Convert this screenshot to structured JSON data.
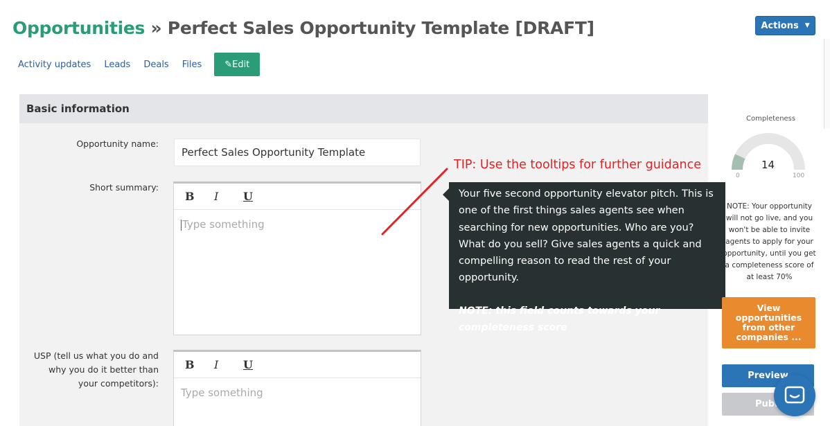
{
  "header": {
    "crumb": "Opportunities",
    "separator": "»",
    "title": "Perfect Sales Opportunity Template [DRAFT]",
    "actions_label": "Actions"
  },
  "tabs": [
    {
      "label": "Activity updates"
    },
    {
      "label": "Leads"
    },
    {
      "label": "Deals"
    },
    {
      "label": "Files"
    }
  ],
  "edit_button": "✎Edit",
  "panel": {
    "heading": "Basic information",
    "fields": {
      "opportunity_name_label": "Opportunity name:",
      "opportunity_name_value": "Perfect Sales Opportunity Template",
      "short_summary_label": "Short summary:",
      "short_summary_placeholder": "Type something",
      "usp_label_line1": "USP (tell us what you do and",
      "usp_label_line2": "why you do it better than",
      "usp_label_line3": "your competitors):",
      "usp_placeholder": "Type something"
    },
    "toolbar": {
      "bold": "B",
      "italic": "I",
      "underline": "U"
    }
  },
  "tip": "TIP: Use the tooltips for further guidance",
  "tooltip": {
    "body": "Your five second opportunity elevator pitch. This is one of the first things sales agents see when searching for new opportunities. Who are you? What do you sell? Give sales agents a quick and compelling reason to read the rest of your opportunity.",
    "note": "NOTE: this field counts towards your completeness score"
  },
  "completeness": {
    "label": "Completeness",
    "value": 14,
    "value_text": "14",
    "min": "0",
    "max": "100",
    "note_lines": [
      "NOTE: Your opportunity",
      "will not go live, and you",
      "won't be able to invite",
      "agents to apply for your",
      "opportunity, until you get",
      "a completeness score of",
      "at least 70%"
    ]
  },
  "sidebar_buttons": {
    "view_other": "View opportunities from other companies ...",
    "preview": "Preview",
    "publish": "Publi"
  },
  "colors": {
    "accent_green": "#2a9d78",
    "primary_blue": "#2b74b6",
    "orange": "#ea8a2e",
    "tooltip_bg": "#273132",
    "tip_red": "#e52222"
  },
  "icons": {
    "chat": "chat-bubble-icon",
    "edit": "pencil-icon",
    "caret": "caret-down-icon"
  }
}
